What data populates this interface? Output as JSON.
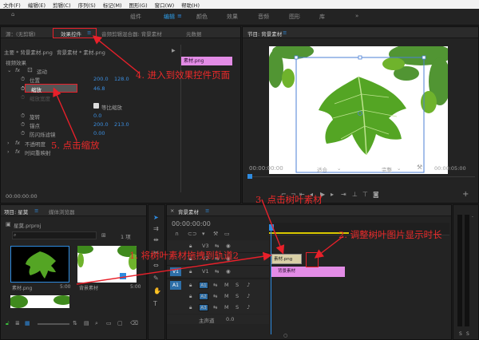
{
  "menu": [
    "文件(F)",
    "编辑(E)",
    "剪辑(C)",
    "序列(S)",
    "标记(M)",
    "图形(G)",
    "窗口(W)",
    "帮助(H)"
  ],
  "workspace_tabs": [
    "组件",
    "编辑",
    "颜色",
    "效果",
    "音频",
    "图形",
    "库"
  ],
  "source_panel": {
    "tabs": [
      "源：(无剪辑)",
      "效果控件",
      "音频剪辑混合器: 背景素材",
      "元数据"
    ],
    "main_clip": "主要 * 背景素材.png",
    "sequence_clip": "背景素材 * 素材.png",
    "section": "视频效果",
    "motion": "运动",
    "position_label": "位置",
    "position_x": "200.0",
    "position_y": "128.0",
    "scale_label": "缩放",
    "scale_value": "46.8",
    "scale_width_label": "缩放宽度",
    "uniform_scale": "等比缩放",
    "rotation_label": "旋转",
    "rotation_value": "0.0",
    "anchor_label": "锚点",
    "anchor_x": "200.0",
    "anchor_y": "213.0",
    "flicker_label": "防闪烁滤镜",
    "flicker_value": "0.00",
    "opacity_label": "不透明度",
    "time_remap_label": "时间重映射",
    "mini_clip": "素材.png",
    "timecode": "00:00:00:00",
    "fx": "fx"
  },
  "program_panel": {
    "title": "节目: 背景素材",
    "timecode": "00:00:00:00",
    "fit": "适合",
    "quality": "完整",
    "duration": "00:00:05:00"
  },
  "project_panel": {
    "tabs": [
      "项目: 星莫",
      "媒体浏览器"
    ],
    "project_file": "星莫.prproj",
    "count": "1 项",
    "items": [
      {
        "name": "素材.png",
        "duration": "5:00"
      },
      {
        "name": "背景素材",
        "duration": "5:00"
      }
    ]
  },
  "timeline": {
    "title": "背景素材",
    "timecode": "00:00:00:00",
    "video_tracks": [
      "V3",
      "V2",
      "V1"
    ],
    "audio_tracks": [
      "A1",
      "A2",
      "A3"
    ],
    "master_label": "主声道",
    "master_value": "0.0",
    "clip_v2": "素材.png",
    "clip_v1": "背景素材"
  },
  "annotations": {
    "a1": "1. 将树叶素材拖拽到轨道2",
    "a2": "2. 调整树叶图片显示时长",
    "a3": "3. 点击树叶素材",
    "a4": "4. 进入到效果控件页面",
    "a5": "5. 点击缩放"
  },
  "colors": {
    "accent_blue": "#2e8be0",
    "annotation_red": "#e8202a",
    "clip_pink": "#e38ce6"
  }
}
